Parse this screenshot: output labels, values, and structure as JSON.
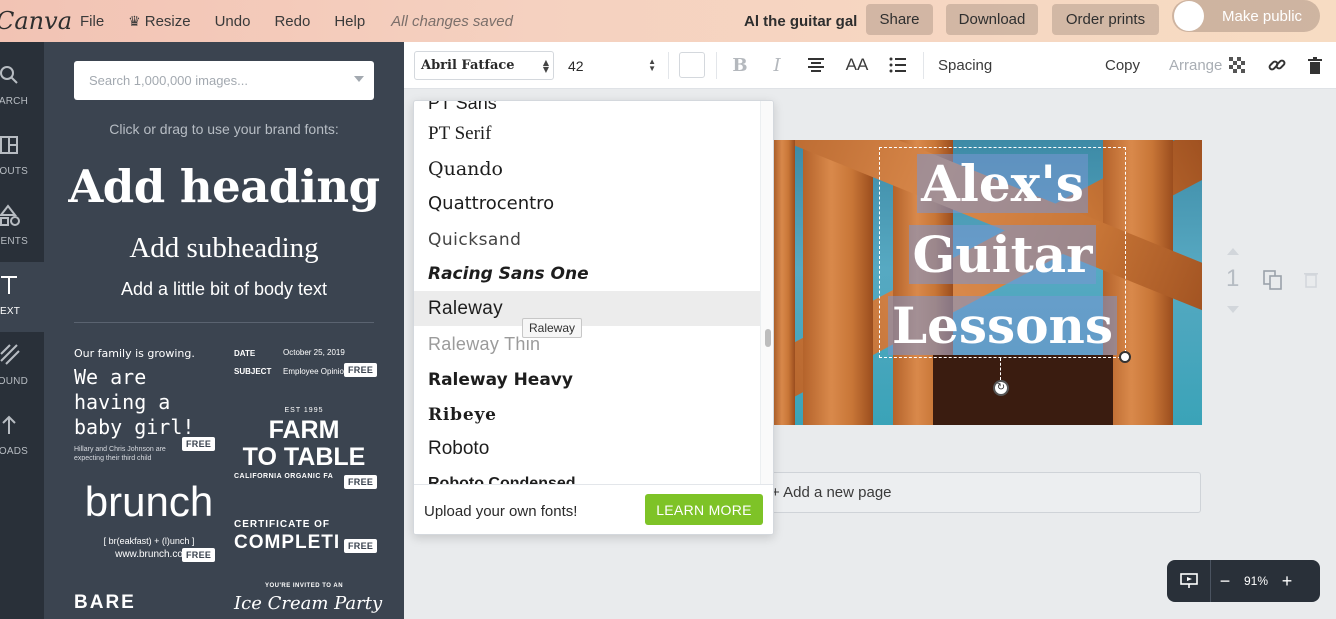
{
  "topbar": {
    "logo": "Canva",
    "menu": [
      {
        "label": "File"
      },
      {
        "label": "Resize"
      },
      {
        "label": "Undo"
      },
      {
        "label": "Redo"
      },
      {
        "label": "Help"
      }
    ],
    "save_status": "All changes saved",
    "design_title": "Al the guitar gal",
    "share_label": "Share",
    "download_label": "Download",
    "order_label": "Order prints",
    "public_label": "Make public"
  },
  "rail": [
    {
      "label": "Search",
      "icon": "search-icon"
    },
    {
      "label": "Layouts",
      "icon": "layouts-icon"
    },
    {
      "label": "Elements",
      "icon": "elements-icon"
    },
    {
      "label": "Text",
      "icon": "text-icon"
    },
    {
      "label": "Background",
      "icon": "background-icon"
    },
    {
      "label": "Uploads",
      "icon": "uploads-icon"
    }
  ],
  "panel": {
    "search_placeholder": "Search 1,000,000 images...",
    "brand_hint": "Click or drag to use your brand fonts:",
    "add_heading": "Add heading",
    "add_subheading": "Add subheading",
    "add_body": "Add a little bit of body text",
    "free_badge": "FREE",
    "templates": {
      "baby_small": "Our family is growing.",
      "baby_big": "We are having a baby girl!",
      "baby_names": "Hillary and Chris Johnson are expecting their third child",
      "memo_date_label": "DATE",
      "memo_date": "October 25, 2019",
      "memo_subject_label": "SUBJECT",
      "memo_subject": "Employee Opinio",
      "farm_est": "EST 1995",
      "farm_line1": "FARM",
      "farm_line2": "TO TABLE",
      "farm_sub": "CALIFORNIA ORGANIC FA",
      "brunch_big": "brunch",
      "brunch_sub": "[ br(eakfast) + (l)unch ]",
      "brunch_url": "www.brunch.co",
      "cert_small": "CERTIFICATE OF",
      "cert_big": "COMPLETI",
      "bare": "BARE",
      "ice_small": "YOU'RE INVITED TO AN",
      "ice_big": "Ice Cream Party"
    }
  },
  "toolbar": {
    "font_name": "Abril Fatface",
    "font_size": "42",
    "spacing_label": "Spacing",
    "copy_label": "Copy",
    "arrange_label": "Arrange",
    "case_label": "AA"
  },
  "font_dropdown": {
    "fonts": [
      "PT Sans",
      "PT Serif",
      "Quando",
      "Quattrocentro",
      "Quicksand",
      "Racing Sans One",
      "Raleway",
      "Raleway Thin",
      "Raleway Heavy",
      "Ribeye",
      "Roboto",
      "Roboto Condensed"
    ],
    "hovered": "Raleway",
    "tooltip": "Raleway",
    "upload_text": "Upload your own fonts!",
    "learn_more": "LEARN MORE"
  },
  "canvas": {
    "headline_lines": [
      "Alex's",
      "Guitar",
      "Lessons"
    ],
    "page_number": "1",
    "add_page": "+ Add a new page",
    "zoom": "91%"
  },
  "colors": {
    "accent_green": "#7ec327",
    "sidebar_dark": "#293039",
    "panel_bg": "#3b4450"
  }
}
